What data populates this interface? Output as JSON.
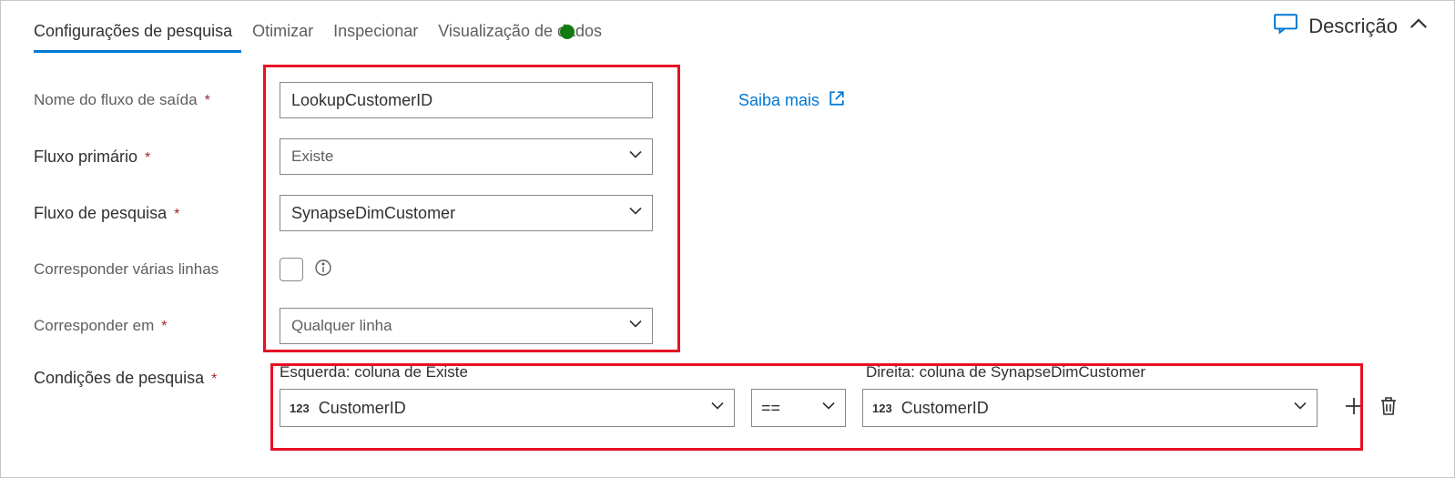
{
  "tabs": {
    "t0": "Configurações de pesquisa",
    "t1": "Otimizar",
    "t2": "Inspecionar",
    "t3": "Visualização de dados"
  },
  "header": {
    "descricao": "Descrição"
  },
  "labels": {
    "outputStream": "Nome do fluxo de saída",
    "primaryStream": "Fluxo primário",
    "lookupStream": "Fluxo de pesquisa",
    "matchMultiple": "Corresponder várias linhas",
    "matchOn": "Corresponder em",
    "lookupConditions": "Condições de pesquisa"
  },
  "fields": {
    "outputStreamName": "LookupCustomerID",
    "primaryStream": "Existe",
    "lookupStream": "SynapseDimCustomer",
    "matchOn": "Qualquer linha"
  },
  "link": {
    "learnMore": "Saiba mais"
  },
  "conditions": {
    "leftHeader": "Esquerda: coluna de Existe",
    "rightHeader": "Direita: coluna de SynapseDimCustomer",
    "row": {
      "leftType": "123",
      "leftCol": "CustomerID",
      "op": "==",
      "rightType": "123",
      "rightCol": "CustomerID"
    }
  }
}
